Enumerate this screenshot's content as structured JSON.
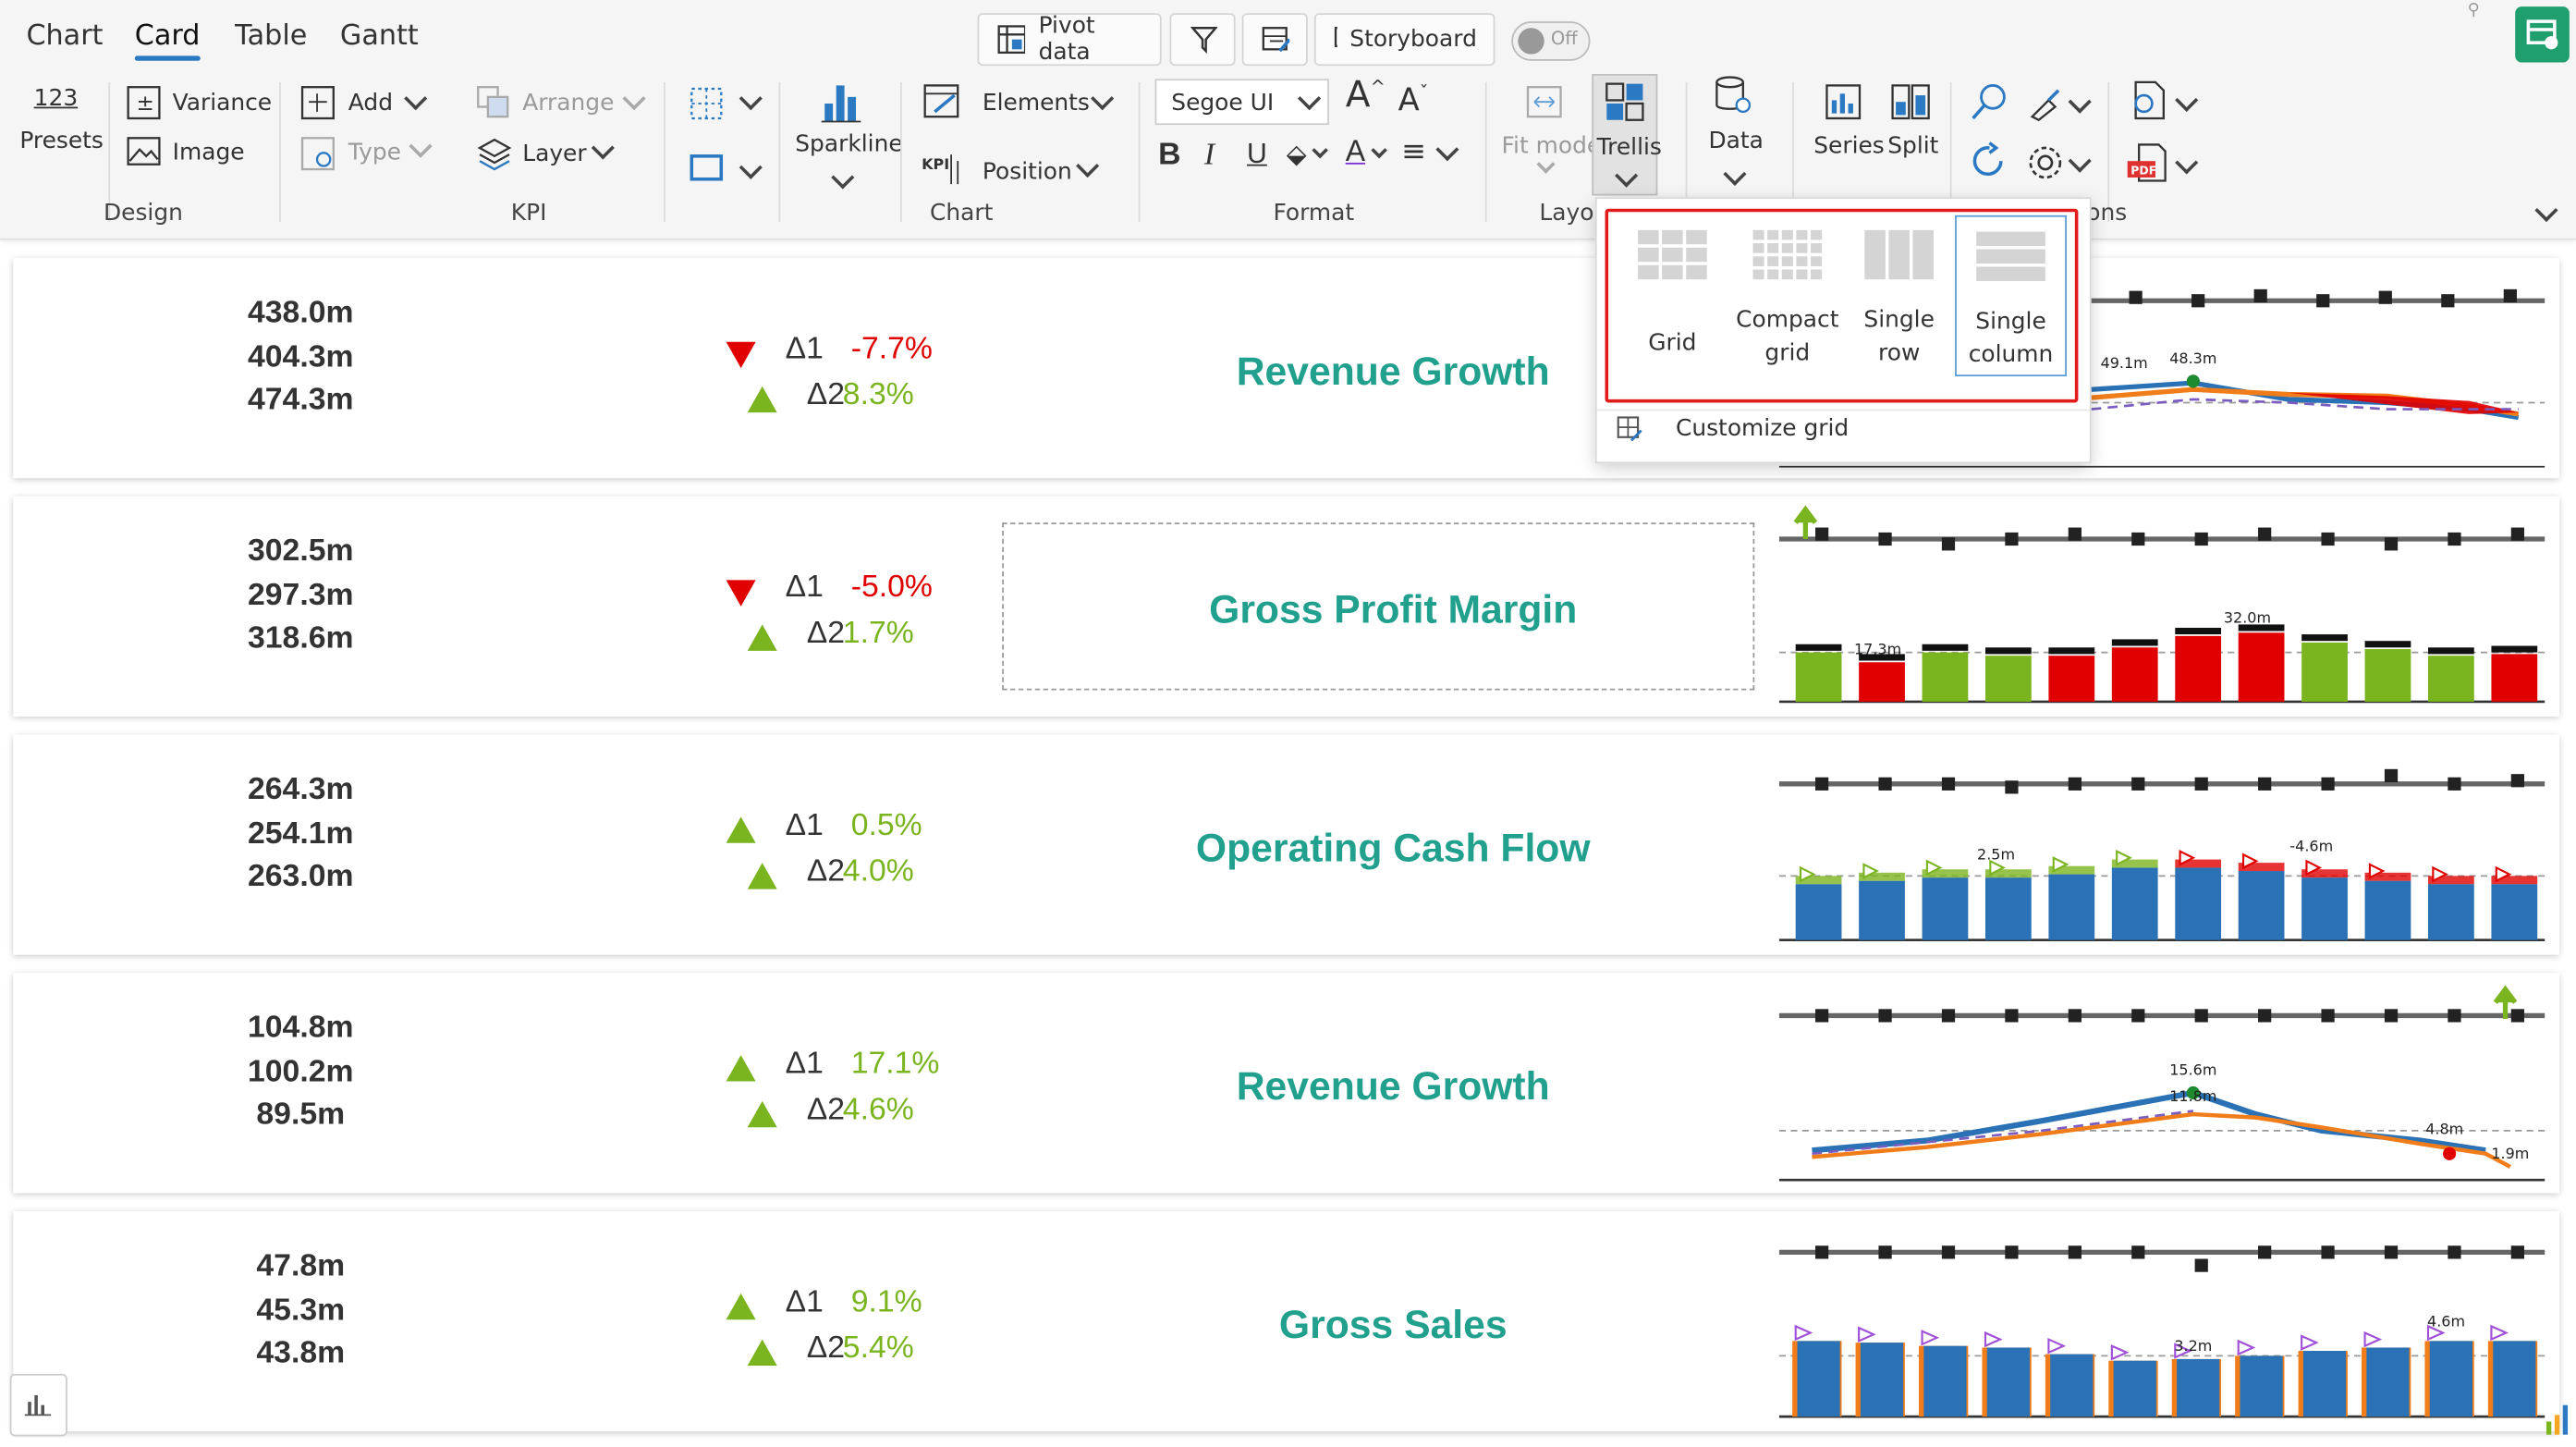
{
  "tabs": [
    "Chart",
    "Card",
    "Table",
    "Gantt"
  ],
  "topbar": {
    "pivot": "Pivot data",
    "storyboard": "Storyboard",
    "toggle": "Off"
  },
  "ribbon": {
    "presets_num": "123",
    "presets": "Presets",
    "variance": "Variance",
    "image": "Image",
    "add": "Add",
    "type": "Type",
    "arrange": "Arrange",
    "layer": "Layer",
    "sparkline": "Sparkline",
    "elements": "Elements",
    "position": "Position",
    "kpi_tag": "KPI",
    "font": "Segoe UI",
    "fit_mode": "Fit mode",
    "trellis": "Trellis",
    "data": "Data",
    "series": "Series",
    "split": "Split"
  },
  "groups": {
    "design": "Design",
    "kpi": "KPI",
    "chart": "Chart",
    "format": "Format",
    "layout": "Layo",
    "options": "ons"
  },
  "trellis_menu": {
    "options": [
      {
        "label": "Grid"
      },
      {
        "label": "Compact grid"
      },
      {
        "label": "Single row"
      },
      {
        "label": "Single column"
      }
    ],
    "customize": "Customize grid"
  },
  "colors": {
    "accent": "#21a08e",
    "up": "#7ab41f",
    "down": "#e00000",
    "selected_border": "#e21b1b",
    "tab_underline": "#2b79c2"
  },
  "cards": [
    {
      "values": [
        "438.0m",
        "404.3m",
        "474.3m"
      ],
      "title": "Revenue Growth",
      "d1_label": "Δ1",
      "d1_value": "-7.7%",
      "d1_dir": "down",
      "d2_label": "Δ2",
      "d2_value": "8.3%",
      "d2_dir": "up",
      "labels": [
        "49.1m",
        "48.3m"
      ]
    },
    {
      "values": [
        "302.5m",
        "297.3m",
        "318.6m"
      ],
      "title": "Gross Profit Margin",
      "d1_label": "Δ1",
      "d1_value": "-5.0%",
      "d1_dir": "down",
      "d2_label": "Δ2",
      "d2_value": "1.7%",
      "d2_dir": "up",
      "labels": [
        "17.3m",
        "32.0m"
      ]
    },
    {
      "values": [
        "264.3m",
        "254.1m",
        "263.0m"
      ],
      "title": "Operating Cash Flow",
      "d1_label": "Δ1",
      "d1_value": "0.5%",
      "d1_dir": "up",
      "d2_label": "Δ2",
      "d2_value": "4.0%",
      "d2_dir": "up",
      "labels": [
        "2.5m",
        "-4.6m"
      ]
    },
    {
      "values": [
        "104.8m",
        "100.2m",
        "89.5m"
      ],
      "title": "Revenue Growth",
      "d1_label": "Δ1",
      "d1_value": "17.1%",
      "d1_dir": "up",
      "d2_label": "Δ2",
      "d2_value": "4.6%",
      "d2_dir": "up",
      "labels": [
        "15.6m",
        "11.8m",
        "4.8m",
        "1.9m"
      ]
    },
    {
      "values": [
        "47.8m",
        "45.3m",
        "43.8m"
      ],
      "title": "Gross Sales",
      "d1_label": "Δ1",
      "d1_value": "9.1%",
      "d1_dir": "up",
      "d2_label": "Δ2",
      "d2_value": "5.4%",
      "d2_dir": "up",
      "labels": [
        "3.2m",
        "4.6m"
      ]
    }
  ]
}
